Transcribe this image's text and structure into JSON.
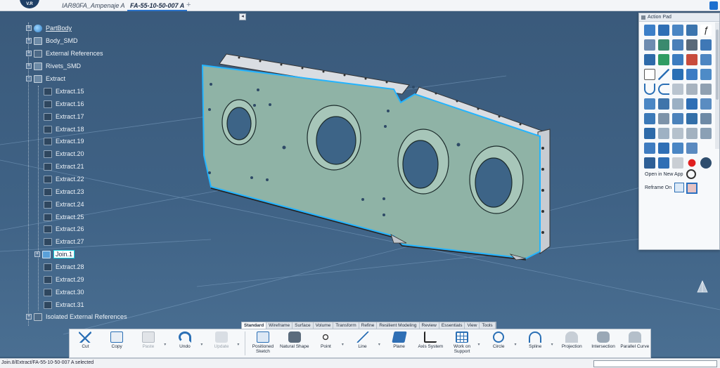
{
  "window": {
    "logo_text": "V.R",
    "tabs": [
      {
        "label": "IAR80FA_Ampenaje A",
        "active": false
      },
      {
        "label": "FA-55-10-50-007 A",
        "active": true
      }
    ],
    "new_tab_symbol": "+"
  },
  "tree": {
    "items": [
      {
        "label": "PartBody",
        "icon": "part-body-icon",
        "expander": "+"
      },
      {
        "label": "Body_SMD",
        "icon": "body-icon",
        "expander": "+"
      },
      {
        "label": "External References",
        "icon": "external-references-icon",
        "expander": "+"
      },
      {
        "label": "Rivets_SMD",
        "icon": "body-icon",
        "expander": "+"
      },
      {
        "label": "Extract",
        "icon": "geometrical-set-icon",
        "expander": "-"
      },
      {
        "label": "Extract.15",
        "icon": "extract-icon"
      },
      {
        "label": "Extract.16",
        "icon": "extract-icon"
      },
      {
        "label": "Extract.17",
        "icon": "extract-icon"
      },
      {
        "label": "Extract.18",
        "icon": "extract-icon"
      },
      {
        "label": "Extract.19",
        "icon": "extract-icon"
      },
      {
        "label": "Extract.20",
        "icon": "extract-icon"
      },
      {
        "label": "Extract.21",
        "icon": "extract-icon"
      },
      {
        "label": "Extract.22",
        "icon": "extract-icon"
      },
      {
        "label": "Extract.23",
        "icon": "extract-icon"
      },
      {
        "label": "Extract.24",
        "icon": "extract-icon"
      },
      {
        "label": "Extract.25",
        "icon": "extract-icon"
      },
      {
        "label": "Extract.26",
        "icon": "extract-icon"
      },
      {
        "label": "Extract.27",
        "icon": "extract-icon"
      },
      {
        "label": "Join.1",
        "icon": "join-icon",
        "expander": "+",
        "selected": true
      },
      {
        "label": "Extract.28",
        "icon": "extract-icon"
      },
      {
        "label": "Extract.29",
        "icon": "extract-icon"
      },
      {
        "label": "Extract.30",
        "icon": "extract-icon"
      },
      {
        "label": "Extract.31",
        "icon": "extract-icon"
      },
      {
        "label": "Isolated External References",
        "icon": "external-references-icon",
        "expander": "+"
      }
    ]
  },
  "action_pad": {
    "title": "Action Pad",
    "open_label": "Open in New App",
    "reframe_label": "Reframe On"
  },
  "bottom_tabs": [
    "Standard",
    "Wireframe",
    "Surface",
    "Volume",
    "Transform",
    "Refine",
    "Resilient Modeling",
    "Review",
    "Essentials",
    "View",
    "Tools"
  ],
  "toolbar": {
    "buttons": [
      {
        "label": "Cut",
        "icon": "scissors-icon"
      },
      {
        "label": "Copy",
        "icon": "copy-icon"
      },
      {
        "label": "Paste",
        "icon": "paste-icon",
        "disabled": true
      },
      {
        "label": "Undo",
        "icon": "undo-icon"
      },
      {
        "label": "Update",
        "icon": "update-icon",
        "disabled": true
      },
      {
        "label": "Positioned Sketch",
        "icon": "positioned-sketch-icon"
      },
      {
        "label": "Natural Shape",
        "icon": "natural-shape-icon"
      },
      {
        "label": "Point",
        "icon": "point-icon"
      },
      {
        "label": "Line",
        "icon": "line-icon"
      },
      {
        "label": "Plane",
        "icon": "plane-icon"
      },
      {
        "label": "Axis System",
        "icon": "axis-system-icon"
      },
      {
        "label": "Work on Support",
        "icon": "grid-icon"
      },
      {
        "label": "Circle",
        "icon": "circle-icon"
      },
      {
        "label": "Spline",
        "icon": "spline-icon"
      },
      {
        "label": "Projection",
        "icon": "projection-icon"
      },
      {
        "label": "Intersection",
        "icon": "intersection-icon"
      },
      {
        "label": "Parallel Curve",
        "icon": "parallel-curve-icon"
      }
    ]
  },
  "status": {
    "text": "Join.8/Extract/FA-55-10-50-007 A selected"
  },
  "colors": {
    "background": "#3f6285",
    "part_fill": "#8fb3a6",
    "part_edge": "#23b4ff",
    "accent": "#2a72c8"
  }
}
